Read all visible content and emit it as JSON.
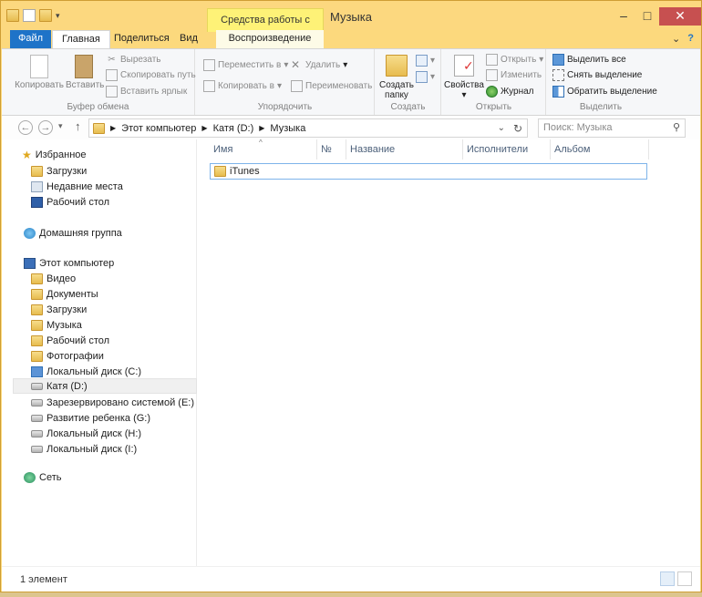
{
  "window": {
    "title": "Музыка",
    "context_header": "Средства работы с музыкой",
    "minimize": "–",
    "maximize": "□",
    "close": "✕"
  },
  "tabs": {
    "file": "Файл",
    "home": "Главная",
    "share": "Поделиться",
    "view": "Вид",
    "playback": "Воспроизведение",
    "collapse": "⌄",
    "help": "?"
  },
  "ribbon": {
    "clipboard": {
      "label": "Буфер обмена",
      "copy": "Копировать",
      "paste": "Вставить",
      "cut": "Вырезать",
      "copy_path": "Скопировать путь",
      "paste_shortcut": "Вставить ярлык"
    },
    "organize": {
      "label": "Упорядочить",
      "move_to": "Переместить в",
      "copy_to": "Копировать в",
      "delete": "Удалить",
      "rename": "Переименовать"
    },
    "new": {
      "label": "Создать",
      "new_folder_line1": "Создать",
      "new_folder_line2": "папку"
    },
    "open": {
      "label": "Открыть",
      "properties": "Свойства",
      "open": "Открыть",
      "edit": "Изменить",
      "history": "Журнал"
    },
    "select": {
      "label": "Выделить",
      "select_all": "Выделить все",
      "select_none": "Снять выделение",
      "invert": "Обратить выделение"
    }
  },
  "address": {
    "crumbs": [
      "Этот компьютер",
      "Катя (D:)",
      "Музыка"
    ],
    "search_placeholder": "Поиск: Музыка"
  },
  "nav": {
    "favorites": "Избранное",
    "fav_items": [
      "Загрузки",
      "Недавние места",
      "Рабочий стол"
    ],
    "homegroup": "Домашняя группа",
    "this_pc": "Этот компьютер",
    "pc_items": [
      "Видео",
      "Документы",
      "Загрузки",
      "Музыка",
      "Рабочий стол",
      "Фотографии",
      "Локальный диск (C:)",
      "Катя (D:)",
      "Зарезервировано системой (E:)",
      "Развитие ребенка (G:)",
      "Локальный диск (H:)",
      "Локальный диск (I:)"
    ],
    "network": "Сеть"
  },
  "columns": {
    "name": "Имя",
    "number": "№",
    "title": "Название",
    "artists": "Исполнители",
    "album": "Альбом"
  },
  "files": [
    {
      "name": "iTunes",
      "type": "folder"
    }
  ],
  "status": {
    "count": "1 элемент"
  }
}
